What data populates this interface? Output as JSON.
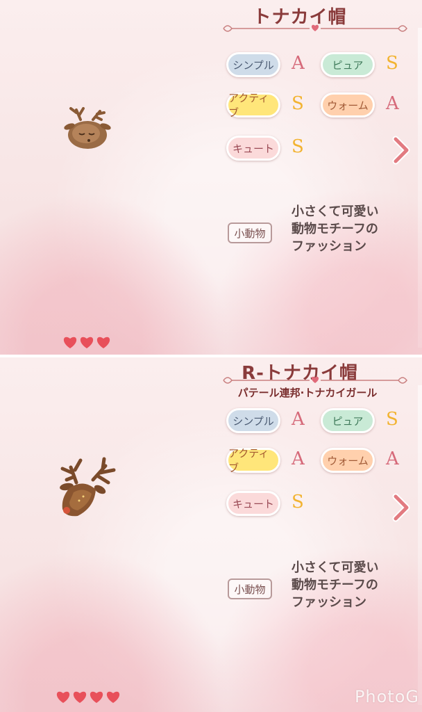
{
  "panels": [
    {
      "title": "トナカイ帽",
      "subtitle": "",
      "styles": [
        {
          "label": "シンプル",
          "rank": "A"
        },
        {
          "label": "ピュア",
          "rank": "S"
        },
        {
          "label": "アクティブ",
          "rank": "S"
        },
        {
          "label": "ウォーム",
          "rank": "A"
        },
        {
          "label": "キュート",
          "rank": "S"
        }
      ],
      "tag": "小動物",
      "description": [
        "小さくて可愛い",
        "動物モチーフの",
        "ファッション"
      ],
      "hearts": 3,
      "icons": {
        "next": "chevron-right-icon",
        "heart": "heart-icon",
        "item": "reindeer-hat-icon"
      }
    },
    {
      "title": "R-トナカイ帽",
      "subtitle": "パテール連邦·トナカイガール",
      "styles": [
        {
          "label": "シンプル",
          "rank": "A"
        },
        {
          "label": "ピュア",
          "rank": "S"
        },
        {
          "label": "アクティブ",
          "rank": "A"
        },
        {
          "label": "ウォーム",
          "rank": "A"
        },
        {
          "label": "キュート",
          "rank": "S"
        }
      ],
      "tag": "小動物",
      "description": [
        "小さくて可愛い",
        "動物モチーフの",
        "ファッション"
      ],
      "hearts": 4,
      "icons": {
        "next": "chevron-right-icon",
        "heart": "heart-icon",
        "item": "reindeer-hat-icon"
      }
    }
  ],
  "colors": {
    "heart": "#e8505a",
    "rank_a": "#d66a7a",
    "rank_s": "#f2b330",
    "title": "#8a3b3b"
  },
  "watermark": "PhotoG"
}
